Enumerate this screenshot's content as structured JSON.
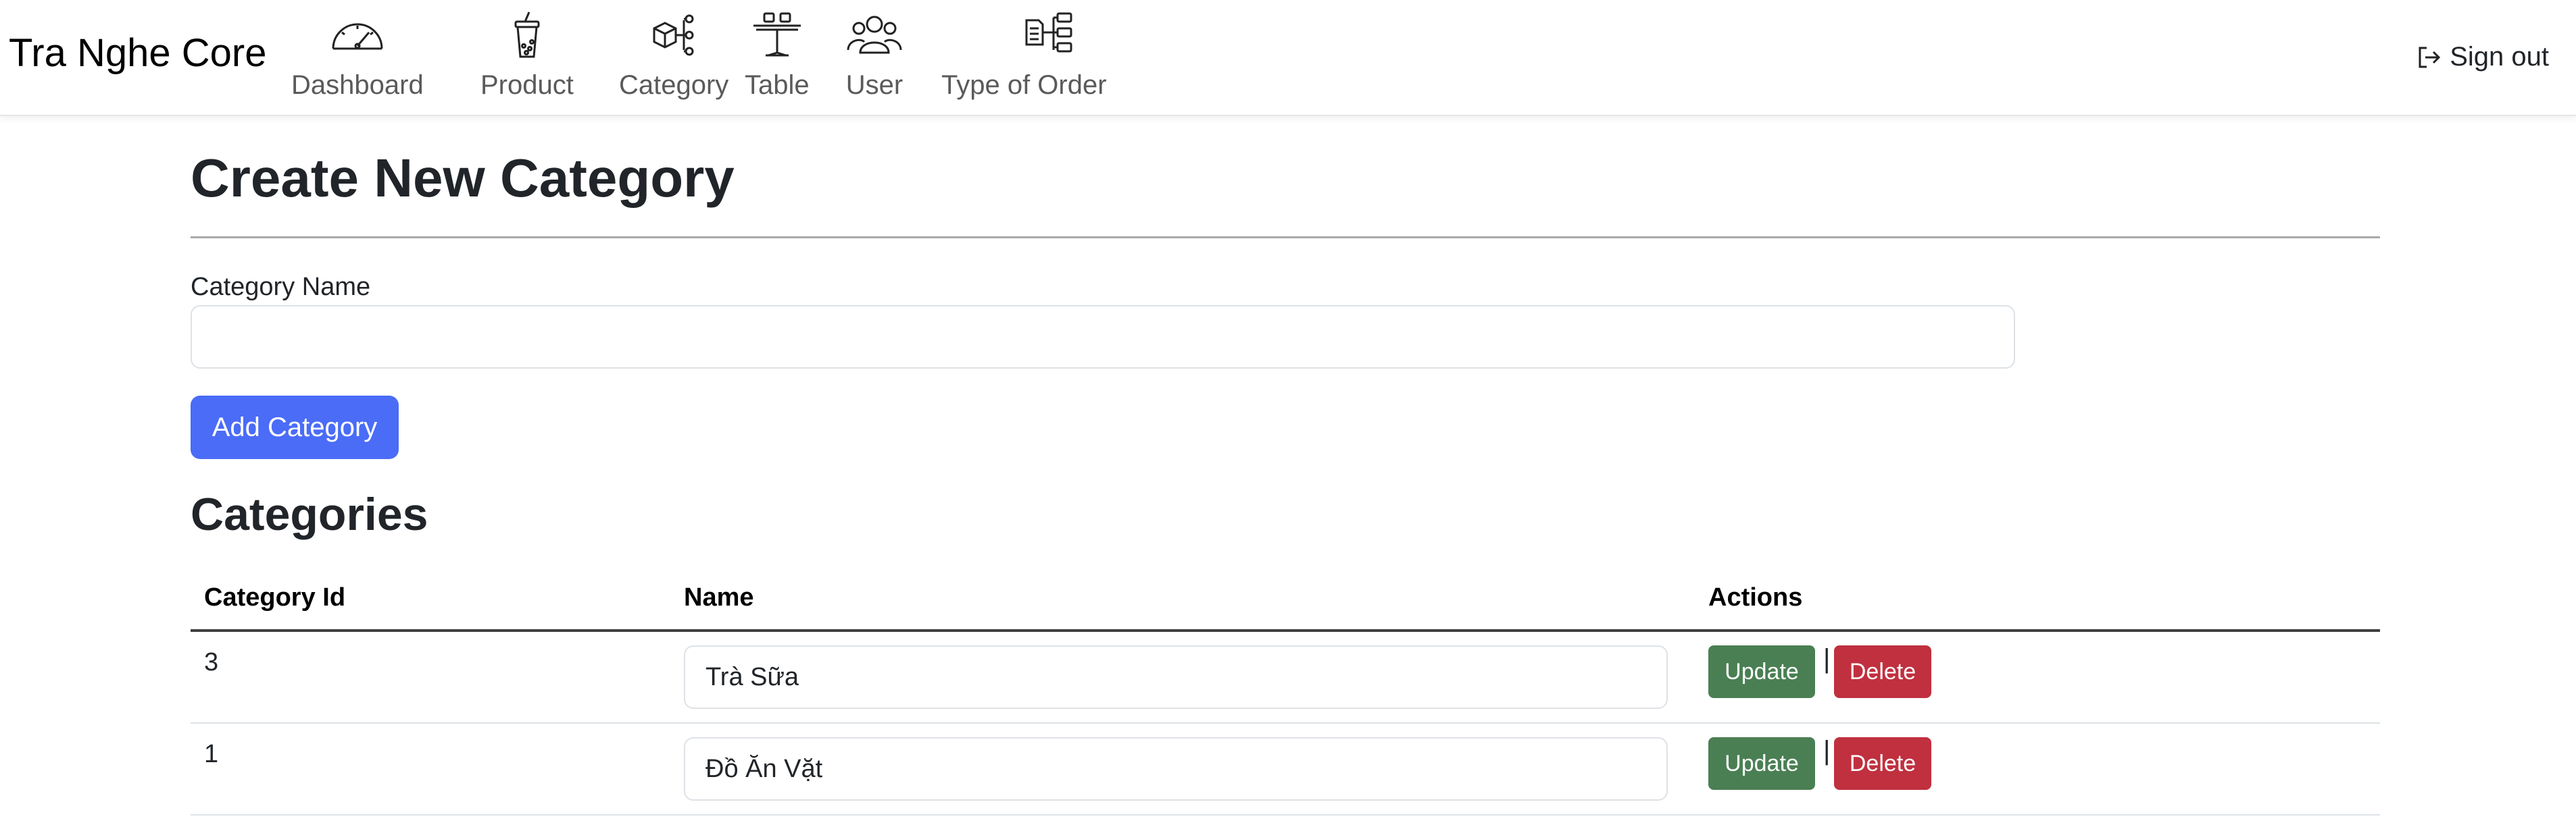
{
  "brand": "Tra Nghe Core",
  "nav": {
    "items": [
      {
        "label": "Dashboard",
        "icon": "gauge-icon"
      },
      {
        "label": "Product",
        "icon": "bubble-tea-icon"
      },
      {
        "label": "Category",
        "icon": "box-network-icon"
      },
      {
        "label": "Table",
        "icon": "table-icon"
      },
      {
        "label": "User",
        "icon": "users-icon"
      },
      {
        "label": "Type of Order",
        "icon": "order-diagram-icon"
      }
    ],
    "signout_label": "Sign out",
    "signout_icon": "sign-out-icon"
  },
  "page": {
    "title": "Create New Category",
    "field_label": "Category Name",
    "field_value": "",
    "add_button": "Add Category",
    "section_title": "Categories"
  },
  "table": {
    "headers": [
      "Category Id",
      "Name",
      "Actions"
    ],
    "rows": [
      {
        "id": "3",
        "name": "Trà Sữa"
      },
      {
        "id": "1",
        "name": "Đồ Ăn Vặt"
      }
    ],
    "update_label": "Update",
    "delete_label": "Delete",
    "separator": "|"
  },
  "colors": {
    "primary": "#4a6cf7",
    "update": "#4a7f53",
    "delete": "#c0303f"
  }
}
